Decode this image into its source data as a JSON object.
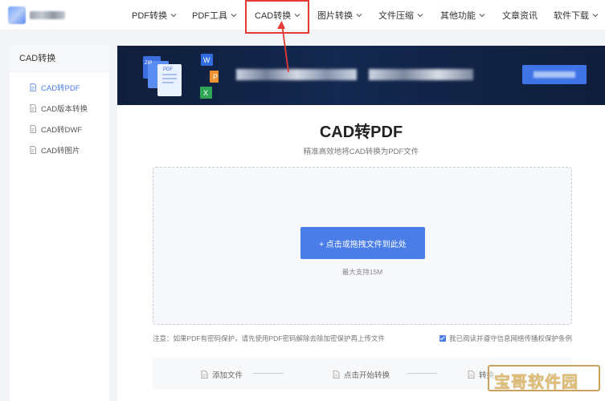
{
  "nav": {
    "items": [
      {
        "label": "PDF转换",
        "dropdown": true
      },
      {
        "label": "PDF工具",
        "dropdown": true
      },
      {
        "label": "CAD转换",
        "dropdown": true
      },
      {
        "label": "图片转换",
        "dropdown": true
      },
      {
        "label": "文件压缩",
        "dropdown": true
      },
      {
        "label": "其他功能",
        "dropdown": true
      },
      {
        "label": "文章资讯",
        "dropdown": false
      },
      {
        "label": "软件下载",
        "dropdown": true
      }
    ]
  },
  "sidebar": {
    "title": "CAD转换",
    "items": [
      {
        "label": "CAD转PDF",
        "active": true,
        "icon": "file-icon"
      },
      {
        "label": "CAD版本转换",
        "active": false,
        "icon": "file-icon"
      },
      {
        "label": "CAD转DWF",
        "active": false,
        "icon": "file-icon"
      },
      {
        "label": "CAD转图片",
        "active": false,
        "icon": "file-icon"
      }
    ]
  },
  "banner": {
    "file_badges": [
      "ZIP",
      "PDF",
      "W",
      "P",
      "X"
    ]
  },
  "main": {
    "title": "CAD转PDF",
    "subtitle": "精准高效地将CAD转换为PDF文件",
    "upload_label": "+ 点击或拖拽文件到此处",
    "max_size": "最大支持15M",
    "note": "注意：如果PDF有密码保护，请先使用PDF密码解除去除加密保护再上传文件",
    "agree_label": "我已阅读并遵守信息网络传播权保护条例",
    "agree_checked": true,
    "steps": [
      "添加文件",
      "点击开始转换",
      "转换"
    ]
  },
  "watermark": {
    "text": "宝哥软件园"
  },
  "colors": {
    "accent": "#4a7de8",
    "highlight": "#e53935",
    "banner_bg": "#132547"
  }
}
